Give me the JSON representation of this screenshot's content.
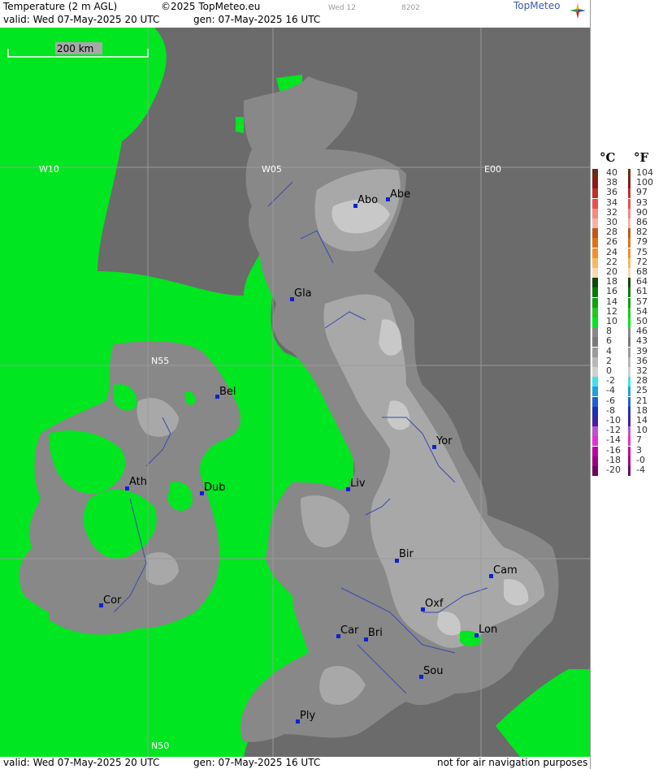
{
  "header": {
    "title": "Temperature (2 m AGL)",
    "copyright": "©2025 TopMeteo.eu",
    "run_day": "Wed 12",
    "code": "8202",
    "valid": "valid:  Wed  07-May-2025  20 UTC",
    "generated": "gen: 07-May-2025 16 UTC",
    "brand": "TopMeteo"
  },
  "map": {
    "scale_label": "200 km",
    "grid_labels": [
      "W10",
      "W05",
      "E00",
      "N55",
      "N50"
    ],
    "cities": [
      "Abo",
      "Abe",
      "Gla",
      "Bel",
      "Yor",
      "Ath",
      "Dub",
      "Liv",
      "Bir",
      "Cam",
      "Cor",
      "Oxf",
      "Car",
      "Bri",
      "Lon",
      "Sou",
      "Ply"
    ],
    "colors": {
      "sea": "#6b6b6b",
      "warm": "#00e620",
      "mid": "#888888",
      "cool": "#a8a8a8",
      "cold": "#c8c8c8",
      "marker": "#1020d0"
    }
  },
  "legend": {
    "unit_c": "°C",
    "unit_f": "°F",
    "celsius": [
      "40",
      "38",
      "36",
      "34",
      "32",
      "30",
      "28",
      "26",
      "24",
      "22",
      "20",
      "18",
      "16",
      "14",
      "12",
      "10",
      "8",
      "6",
      "4",
      "2",
      "0",
      "-2",
      "-4",
      "-6",
      "-8",
      "-10",
      "-12",
      "-14",
      "-16",
      "-18",
      "-20"
    ],
    "fahrenheit": [
      "104",
      "100",
      "97",
      "93",
      "90",
      "86",
      "82",
      "79",
      "75",
      "72",
      "68",
      "64",
      "61",
      "57",
      "54",
      "50",
      "46",
      "43",
      "39",
      "36",
      "32",
      "28",
      "25",
      "21",
      "18",
      "14",
      "10",
      "7",
      "3",
      "-0",
      "-4"
    ],
    "colors": [
      "#6e2a14",
      "#8a1a1a",
      "#c0302a",
      "#e8504a",
      "#f08a84",
      "#f8b0a8",
      "#c05a1a",
      "#e0701a",
      "#f09030",
      "#f8b860",
      "#f8d8b0",
      "#0a4a0a",
      "#0a7a0a",
      "#10a010",
      "#20c820",
      "#00e620",
      "#888888",
      "#7a7a7a",
      "#9a9a9a",
      "#b8b8b8",
      "#d0d0d0",
      "#40e0f0",
      "#20a0e0",
      "#2060d0",
      "#2030b0",
      "#4020a0",
      "#c050d0",
      "#e030d0",
      "#c000a0",
      "#a00080",
      "#700060"
    ]
  },
  "footer": {
    "valid": "valid:  Wed  07-May-2025  20 UTC",
    "generated": "gen: 07-May-2025 16 UTC",
    "notice": "not for air navigation purposes"
  }
}
